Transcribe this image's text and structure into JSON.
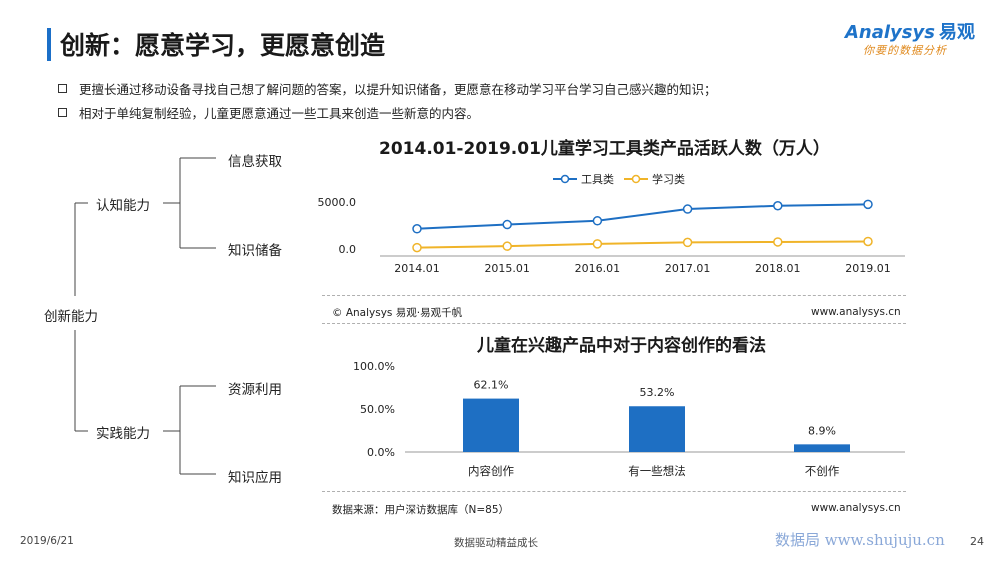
{
  "header": {
    "title": "创新：愿意学习，更愿意创造",
    "logo_main": "Analysys",
    "logo_cn": "易观",
    "logo_sub": "你要的数据分析"
  },
  "bullets": [
    "更擅长通过移动设备寻找自己想了解问题的答案，以提升知识储备，更愿意在移动学习平台学习自己感兴趣的知识；",
    "相对于单纯复制经验，儿童更愿意通过一些工具来创造一些新意的内容。"
  ],
  "tree": {
    "root": "创新能力",
    "branches": [
      {
        "label": "认知能力",
        "leaves": [
          "信息获取",
          "知识储备"
        ]
      },
      {
        "label": "实践能力",
        "leaves": [
          "资源利用",
          "知识应用"
        ]
      }
    ]
  },
  "chart_data": [
    {
      "type": "line",
      "title": "2014.01-2019.01儿童学习工具类产品活跃人数（万人）",
      "x": [
        "2014.01",
        "2015.01",
        "2016.01",
        "2017.01",
        "2018.01",
        "2019.01"
      ],
      "series": [
        {
          "name": "工具类",
          "color": "#1e6fc3",
          "values": [
            2150,
            2600,
            3000,
            4250,
            4600,
            4750
          ]
        },
        {
          "name": "学习类",
          "color": "#f0b429",
          "values": [
            150,
            300,
            550,
            700,
            750,
            800
          ]
        }
      ],
      "y_tick_labels": [
        "5000.0",
        "0.0"
      ],
      "ylim": [
        0,
        5000
      ],
      "legend": "top-center",
      "grid": false
    },
    {
      "type": "bar",
      "title": "儿童在兴趣产品中对于内容创作的看法",
      "categories": [
        "内容创作",
        "有一些想法",
        "不创作"
      ],
      "values": [
        62.1,
        53.2,
        8.9
      ],
      "value_labels": [
        "62.1%",
        "53.2%",
        "8.9%"
      ],
      "color": "#1e6fc3",
      "y_tick_labels": [
        "100.0%",
        "50.0%",
        "0.0%"
      ],
      "ylim": [
        0,
        100
      ],
      "grid": false
    }
  ],
  "notes": {
    "chart1_source": "© Analysys 易观·易观千帆",
    "chart1_site": "www.analysys.cn",
    "chart2_source": "数据来源：用户深访数据库（N=85）",
    "chart2_site": "www.analysys.cn"
  },
  "footer": {
    "date": "2019/6/21",
    "slogan": "数据驱动精益成长",
    "brand": "数据局 www.shujuju.cn",
    "page": "24"
  }
}
